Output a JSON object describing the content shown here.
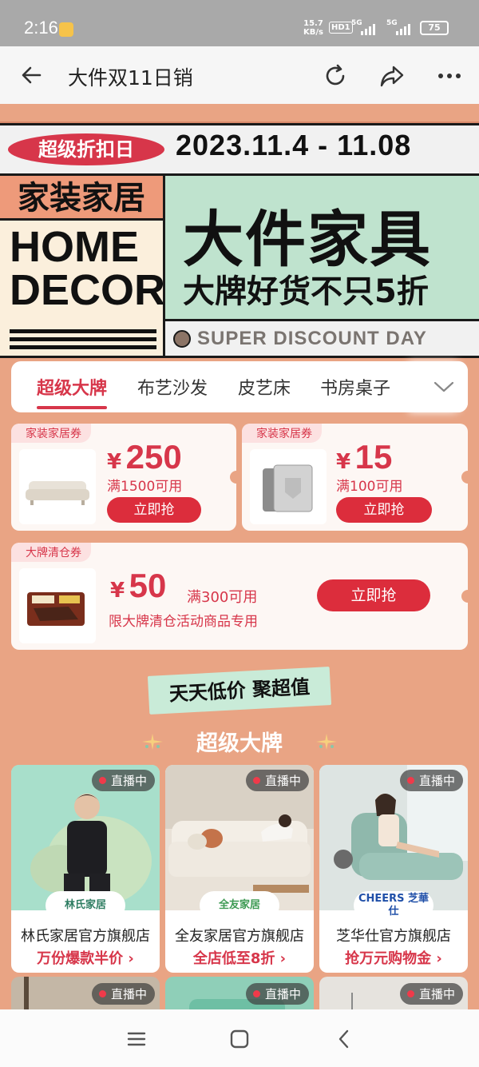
{
  "status_bar": {
    "time": "2:16",
    "net_speed": "15.7",
    "net_unit": "KB/s",
    "hd": "HD1",
    "sig1": "5G",
    "sig2": "5G",
    "battery": "75"
  },
  "nav": {
    "title": "大件双11日销",
    "icons": [
      "back-arrow-icon",
      "refresh-icon",
      "share-icon",
      "more-icon"
    ]
  },
  "hero": {
    "pill": "超级折扣日",
    "dates": "2023.11.4 - 11.08",
    "left_cn": "家装家居",
    "left_en_1": "HOME",
    "left_en_2": "DECOR",
    "headline": "大件家具",
    "subline": "大牌好货不只5折",
    "super_day": "SUPER DISCOUNT DAY"
  },
  "tabs": {
    "items": [
      "超级大牌",
      "布艺沙发",
      "皮艺床",
      "书房桌子"
    ],
    "active_index": 0
  },
  "coupons": [
    {
      "tag": "家装家居券",
      "currency": "¥",
      "amount": "250",
      "condition": "满1500可用",
      "button": "立即抢"
    },
    {
      "tag": "家装家居券",
      "currency": "¥",
      "amount": "15",
      "condition": "满100可用",
      "button": "立即抢"
    },
    {
      "tag": "大牌清仓券",
      "currency": "¥",
      "amount": "50",
      "condition": "满300可用",
      "note": "限大牌清仓活动商品专用",
      "button": "立即抢"
    }
  ],
  "banner": {
    "slogan": "天天低价 聚超值",
    "section_title": "超级大牌"
  },
  "stores": [
    {
      "live": "直播中",
      "logo": "林氏家居",
      "name": "林氏家居官方旗舰店",
      "promo": "万份爆款半价 ›"
    },
    {
      "live": "直播中",
      "logo": "全友家居",
      "name": "全友家居官方旗舰店",
      "promo": "全店低至8折 ›"
    },
    {
      "live": "直播中",
      "logo": "CHEERS 芝華仕",
      "name": "芝华仕官方旗舰店",
      "promo": "抢万元购物金 ›"
    }
  ],
  "stores_row2": [
    {
      "live": "直播中"
    },
    {
      "live": "直播中"
    },
    {
      "live": "直播中"
    }
  ],
  "colors": {
    "page_bg": "#E9A484",
    "accent_red": "#D7364A",
    "mint": "#BFE3CE"
  }
}
